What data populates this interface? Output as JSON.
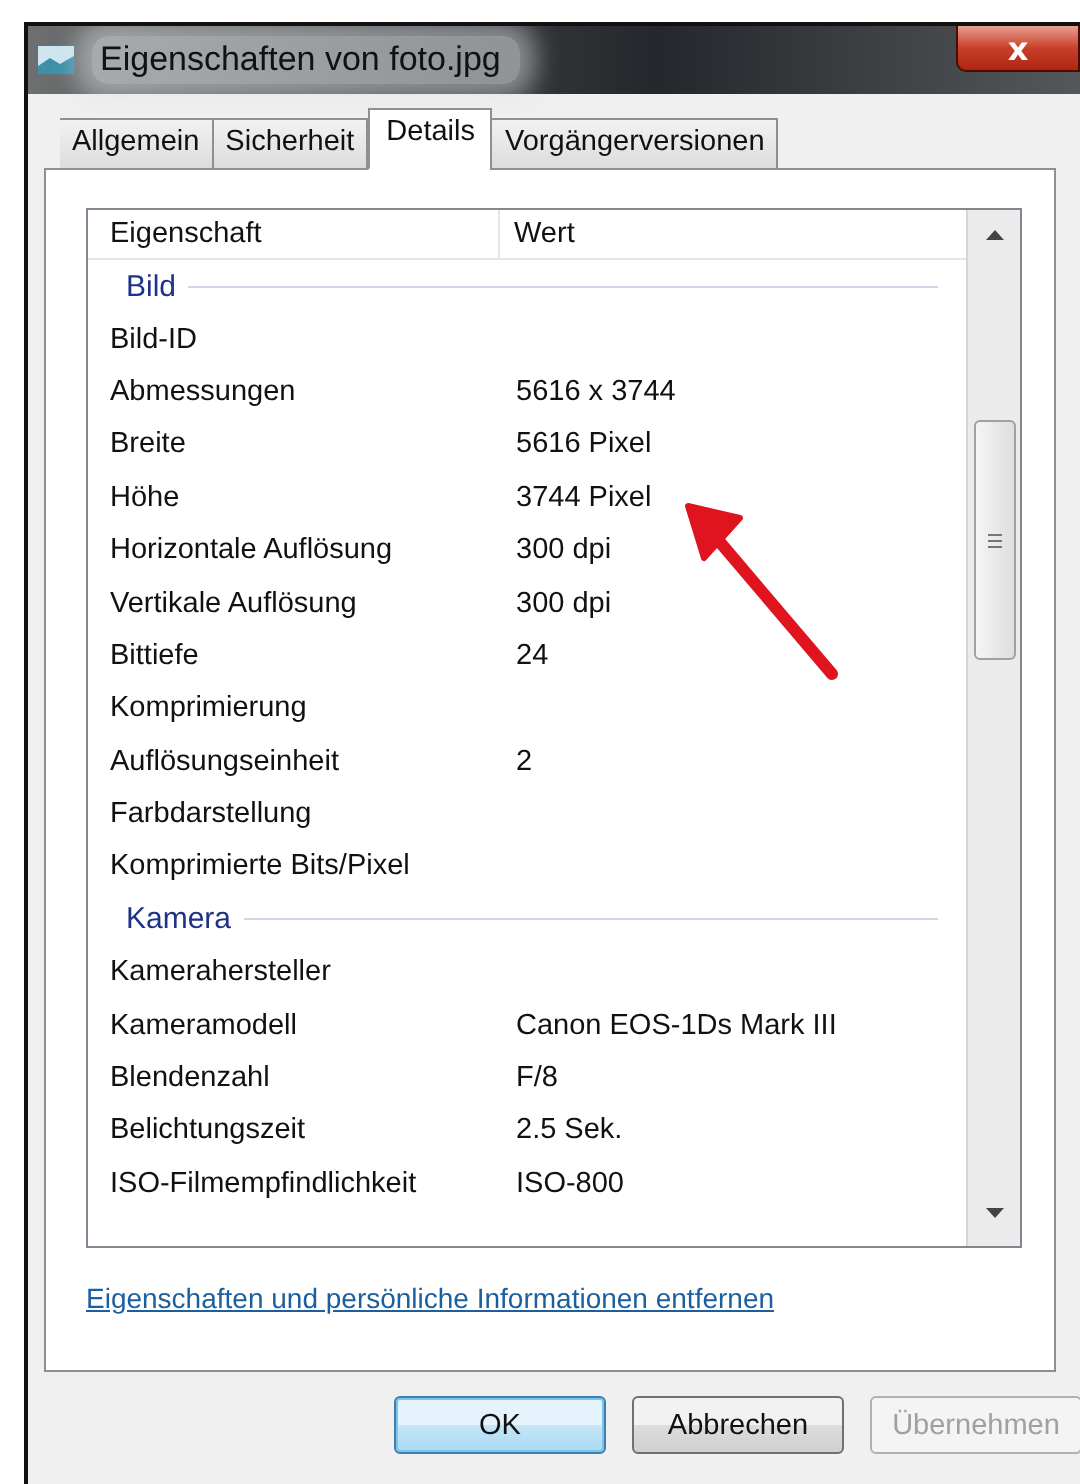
{
  "window": {
    "title": "Eigenschaften von foto.jpg",
    "close": "x"
  },
  "tabs": [
    {
      "label": "Allgemein",
      "selected": false
    },
    {
      "label": "Sicherheit",
      "selected": false
    },
    {
      "label": "Details",
      "selected": true
    },
    {
      "label": "Vorgängerversionen",
      "selected": false
    }
  ],
  "table": {
    "columns": [
      "Eigenschaft",
      "Wert"
    ],
    "rows": [
      {
        "kind": "group",
        "name": "Bild"
      },
      {
        "kind": "property",
        "name": "Bild-ID"
      },
      {
        "kind": "property",
        "name": "Abmessungen",
        "value": "5616 x 3744"
      },
      {
        "kind": "property",
        "name": "Breite",
        "value": "5616 Pixel"
      },
      {
        "kind": "property",
        "name": "Höhe",
        "value": "3744 Pixel"
      },
      {
        "kind": "property",
        "name": "Horizontale Auflösung",
        "value": "300 dpi"
      },
      {
        "kind": "property",
        "name": "Vertikale Auflösung",
        "value": "300 dpi"
      },
      {
        "kind": "property",
        "name": "Bittiefe",
        "value": "24"
      },
      {
        "kind": "property",
        "name": "Komprimierung"
      },
      {
        "kind": "property",
        "name": "Auflösungseinheit",
        "value": "2"
      },
      {
        "kind": "property",
        "name": "Farbdarstellung"
      },
      {
        "kind": "property",
        "name": "Komprimierte Bits/Pixel"
      },
      {
        "kind": "group",
        "name": "Kamera"
      },
      {
        "kind": "property",
        "name": "Kamerahersteller"
      },
      {
        "kind": "property",
        "name": "Kameramodell",
        "value": "Canon EOS-1Ds Mark III"
      },
      {
        "kind": "property",
        "name": "Blendenzahl",
        "value": "F/8"
      },
      {
        "kind": "property",
        "name": "Belichtungszeit",
        "value": "2.5 Sek."
      },
      {
        "kind": "property",
        "name": "ISO-Filmempfindlichkeit",
        "value": "ISO-800"
      }
    ]
  },
  "link": "Eigenschaften und persönliche Informationen entfernen",
  "buttons": [
    {
      "label": "OK",
      "default": true,
      "disabled": false
    },
    {
      "label": "Abbrechen",
      "default": false,
      "disabled": false
    },
    {
      "label": "Übernehmen",
      "default": false,
      "disabled": true
    }
  ]
}
